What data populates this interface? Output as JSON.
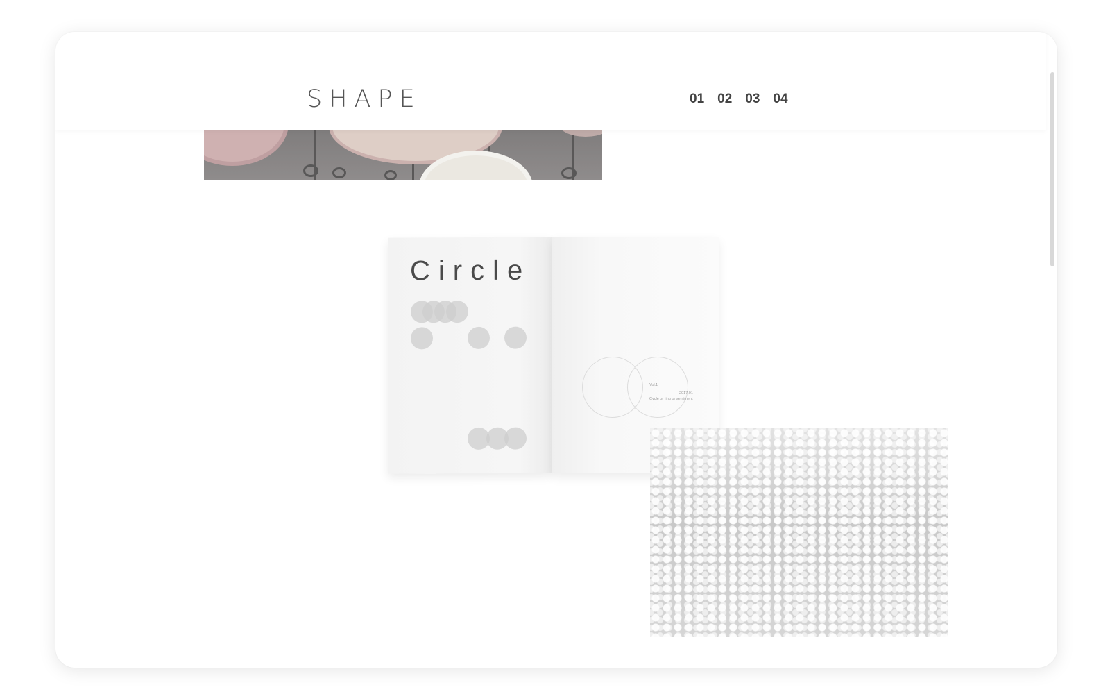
{
  "window": {
    "controls": [
      {
        "name": "green-dot",
        "color": "#c5dfa7"
      },
      {
        "name": "orange-dot",
        "color": "#fbc393"
      },
      {
        "name": "pink-dot",
        "color": "#f3a6c7"
      }
    ]
  },
  "header": {
    "logo": "SHAPE",
    "nav": [
      "01",
      "02",
      "03",
      "04"
    ]
  },
  "magazine": {
    "title": "Circle",
    "vol": "Vol.1",
    "date": "2017.01",
    "caption": "Cycle or ring or sentiment"
  }
}
